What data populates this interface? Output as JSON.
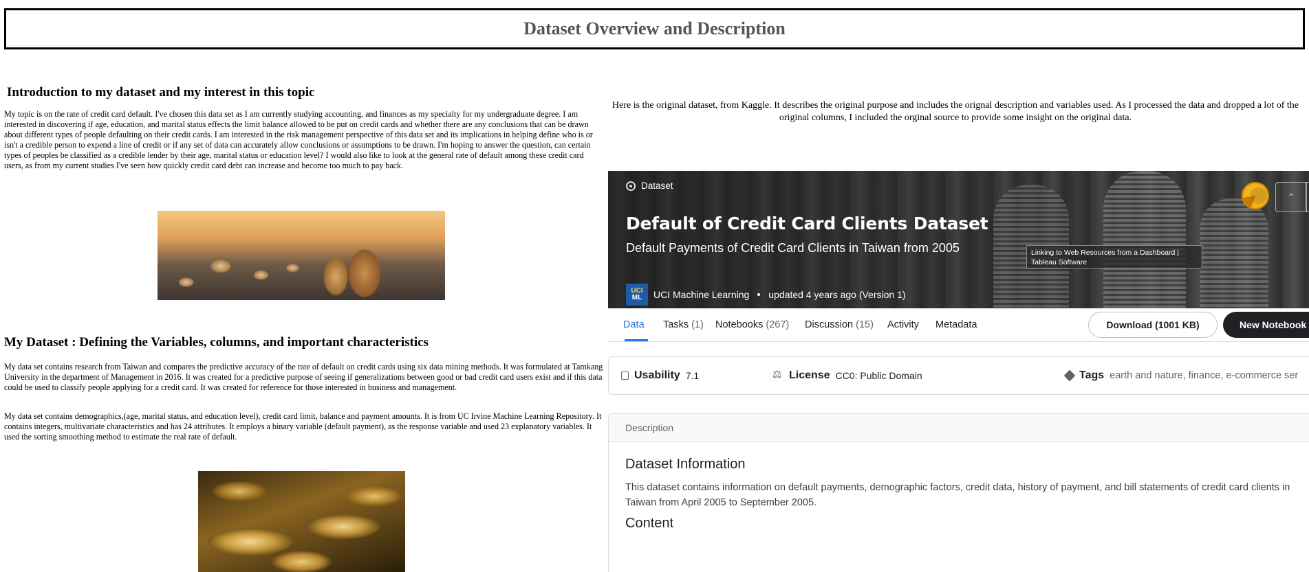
{
  "page": {
    "title": "Dataset Overview and Description"
  },
  "left": {
    "intro_heading": "Introduction to my dataset and my interest in this topic",
    "intro_text": "  My topic is on the rate of credit card default. I've chosen this data set as I am currently studying accounting, and finances as my specialty for my undergraduate degree. I am interested in discovering if age, education, and marital status effects the limit balance allowed to be put on credit cards and whether there are any conclusions that can be drawn about different types of people defaulting on their credit cards. I am interested in the risk management perspective of this data set and its implications in helping define who is or isn't a credible person to expend a line of credit or if any set of data can accurately allow conclusions or assumptions to be drawn. I'm hoping to answer the question, can certain types of peoples be classified as a credible lender by their age, marital status or education level? I would also like to look at the general rate of default among these credit card users, as from my current studies I've seen how quickly credit card debt can increase and become too much to pay back.",
    "dataset_heading": "My Dataset : Defining the Variables, columns, and important characteristics",
    "dataset_text_1": "My data set contains research from Taiwan and compares the predictive accuracy of the rate of default on credit cards using six data mining methods. It was formulated at Tamkang University in the department of Management in 2016. It was created for a predictive purpose of seeing if generalizations between good or bad credit card users exist and if this data could be used to classify people applying for a credit card. It was created for reference for those interested in business and management.",
    "dataset_text_2": "My data set contains demographics,(age, marital status, and education level), credit card limit, balance and payment amounts. It is from UC Irvine Machine Learning Repository. It contains integers, multivariate characteristics and has 24 attributes. It employs a binary variable (default payment), as the response variable and used 23 explanatory variables. It used the sorting smoothing method to estimate the real rate of default."
  },
  "right": {
    "intro_text": "Here is the original dataset, from Kaggle. It describes the original purpose and includes the orignal description and variables used. As I processed the data and dropped a lot of the original columns, I included the orginal source to provide some insight on the original data."
  },
  "kaggle": {
    "label": "Dataset",
    "title": "Default of Credit Card Clients Dataset",
    "subtitle": "Default Payments of Credit Card Clients in Taiwan from 2005",
    "tooltip": "Linking to Web Resources from a Dashboard | Tableau Software",
    "logo_top": "UCI",
    "logo_bottom": "ML",
    "owner": "UCI Machine Learning",
    "updated": "updated 4 years ago (Version 1)",
    "up_icon": "chevron-up-icon",
    "tabs": [
      {
        "label": "Data",
        "count": ""
      },
      {
        "label": "Tasks",
        "count": "(1)"
      },
      {
        "label": "Notebooks",
        "count": "(267)"
      },
      {
        "label": "Discussion",
        "count": "(15)"
      },
      {
        "label": "Activity",
        "count": ""
      },
      {
        "label": "Metadata",
        "count": ""
      }
    ],
    "download_label": "Download (1001 KB)",
    "new_notebook_label": "New Notebook",
    "usability_key": "Usability",
    "usability_val": "7.1",
    "license_key": "License",
    "license_val": "CC0: Public Domain",
    "tags_key": "Tags",
    "tags_val": "earth and nature, finance, e-commerce ser",
    "description_header": "Description",
    "info_heading": "Dataset Information",
    "info_text": "This dataset contains information on default payments, demographic factors, credit data, history of payment, and bill statements of credit card clients in Taiwan from April 2005 to September 2005.",
    "content_heading": "Content",
    "accent": "#1a73e8"
  }
}
